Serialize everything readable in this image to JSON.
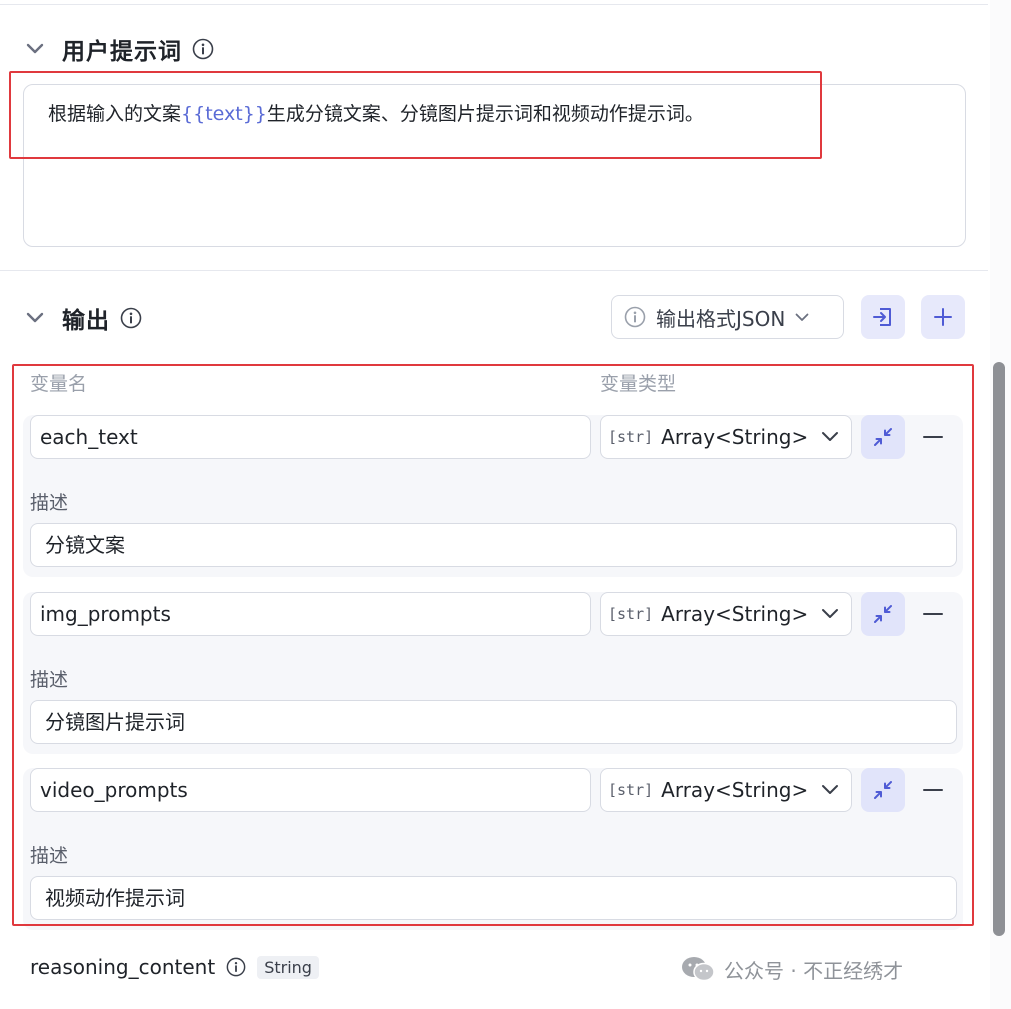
{
  "user_prompt": {
    "title": "用户提示词",
    "text_before": "根据输入的文案",
    "variable_token": "{{text}}",
    "text_after": "生成分镜文案、分镜图片提示词和视频动作提示词。"
  },
  "output": {
    "title": "输出",
    "format_button_label": "输出格式JSON",
    "column_name_header": "变量名",
    "column_type_header": "变量类型",
    "description_label": "描述",
    "type_icon_text": "[str]",
    "variables": [
      {
        "name": "each_text",
        "type": "Array<String>",
        "description": "分镜文案"
      },
      {
        "name": "img_prompts",
        "type": "Array<String>",
        "description": "分镜图片提示词"
      },
      {
        "name": "video_prompts",
        "type": "Array<String>",
        "description": "视频动作提示词"
      }
    ],
    "extra_field": {
      "name": "reasoning_content",
      "type_badge": "String"
    }
  },
  "watermark": {
    "text": "公众号 · 不正经绣才",
    "icon": "wechat-icon"
  },
  "colors": {
    "accent": "#5a6bd6",
    "highlight_box": "#e0393e",
    "icon_button_bg": "#e7e9fb"
  }
}
